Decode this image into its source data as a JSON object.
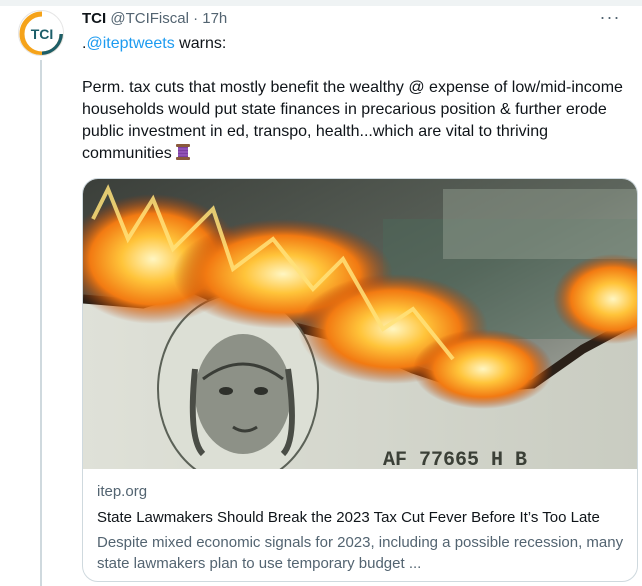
{
  "tweet": {
    "author_name": "TCI",
    "handle": "@TCIFiscal",
    "separator": "·",
    "time": "17h",
    "more_label": "···",
    "avatar_text": "TCI",
    "quote_prefix": ".",
    "mention": "@iteptweets",
    "quote_suffix": " warns:",
    "body": "Perm. tax cuts that mostly benefit the wealthy @ expense of low/mid-income households would put state finances in precarious position & further erode public investment in ed, transpo, health...which are vital to thriving communities",
    "emoji": "thread-spool"
  },
  "card": {
    "image_description_icon": "burning-dollar-bill",
    "bill_text": "AF 77665 H B",
    "domain": "itep.org",
    "title": "State Lawmakers Should Break the 2023 Tax Cut Fever Before It’s Too Late",
    "description": "Despite mixed economic signals for 2023, including a possible recession, many state lawmakers plan to use temporary budget ..."
  },
  "colors": {
    "link": "#1d9bf0",
    "secondary_text": "#536471",
    "brand_orange": "#f5a31a",
    "brand_teal": "#1c5e69"
  }
}
